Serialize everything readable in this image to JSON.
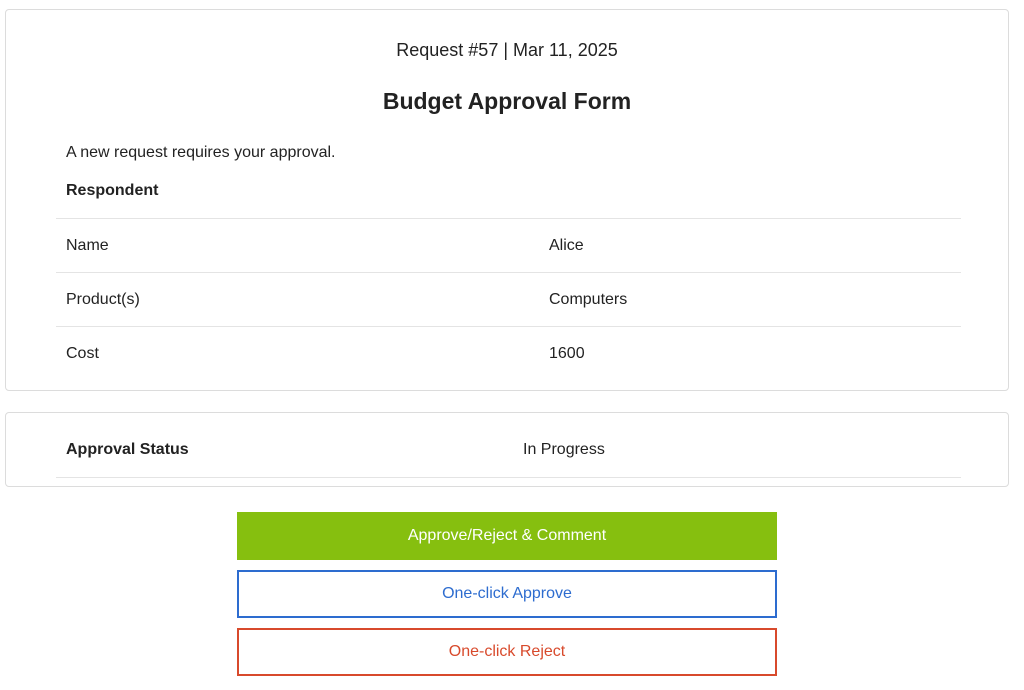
{
  "header": {
    "request_meta": "Request #57 | Mar 11, 2025",
    "title": "Budget Approval Form"
  },
  "intro": "A new request requires your approval.",
  "respondent": {
    "section_label": "Respondent",
    "rows": [
      {
        "label": "Name",
        "value": "Alice"
      },
      {
        "label": "Product(s)",
        "value": "Computers"
      },
      {
        "label": "Cost",
        "value": "1600"
      }
    ]
  },
  "status": {
    "label": "Approval Status",
    "value": "In Progress"
  },
  "actions": {
    "primary_label": "Approve/Reject & Comment",
    "approve_label": "One-click Approve",
    "reject_label": "One-click Reject"
  },
  "colors": {
    "primary": "#86bf0f",
    "approve": "#2d6ccf",
    "reject": "#d84a2c"
  }
}
